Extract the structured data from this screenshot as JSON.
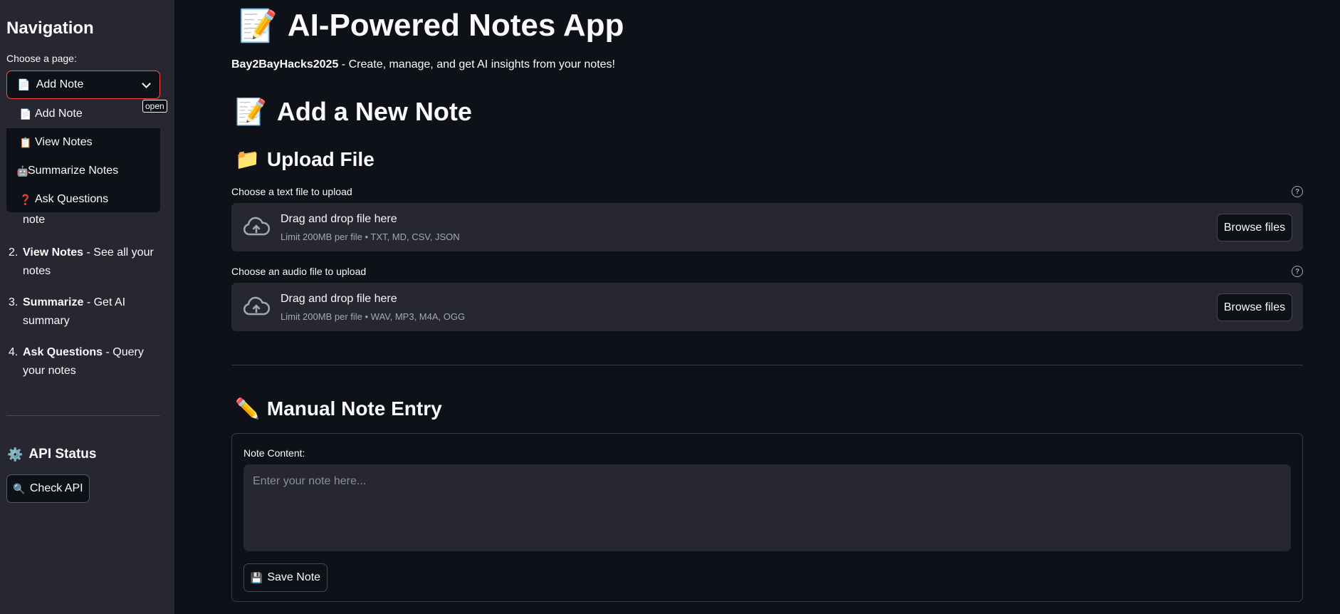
{
  "sidebar": {
    "title": "Navigation",
    "select_label": "Choose a page:",
    "selected_icon": "📄",
    "selected_value": "Add Note",
    "tooltip": "open",
    "options": [
      {
        "icon": "📄",
        "label": "Add Note"
      },
      {
        "icon": "📋",
        "label": "View Notes"
      },
      {
        "icon": "🤖",
        "label": "Summarize Notes"
      },
      {
        "icon": "❓",
        "label": "Ask Questions"
      }
    ],
    "instructions_fragment": "note",
    "instructions": [
      {
        "num": "2.",
        "bold": "View Notes",
        "text": " - See all your notes"
      },
      {
        "num": "3.",
        "bold": "Summarize",
        "text": " - Get AI summary"
      },
      {
        "num": "4.",
        "bold": "Ask Questions",
        "text": " - Query your notes"
      }
    ],
    "api_status_title": "API Status",
    "api_status_icon": "⚙️",
    "check_api_icon": "🔍",
    "check_api_label": "Check API"
  },
  "main": {
    "title_icon": "📝",
    "title": "AI-Powered Notes App",
    "subtitle_bold": "Bay2BayHacks2025",
    "subtitle_text": " - Create, manage, and get AI insights from your notes!",
    "add_heading_icon": "📝",
    "add_heading": "Add a New Note",
    "upload_heading_icon": "📁",
    "upload_heading": "Upload File",
    "text_upload": {
      "label": "Choose a text file to upload",
      "drag_text": "Drag and drop file here",
      "limit_text": "Limit 200MB per file • TXT, MD, CSV, JSON",
      "browse_label": "Browse files"
    },
    "audio_upload": {
      "label": "Choose an audio file to upload",
      "drag_text": "Drag and drop file here",
      "limit_text": "Limit 200MB per file • WAV, MP3, M4A, OGG",
      "browse_label": "Browse files"
    },
    "manual_heading_icon": "✏️",
    "manual_heading": "Manual Note Entry",
    "note_label": "Note Content:",
    "note_placeholder": "Enter your note here...",
    "save_icon": "💾",
    "save_label": "Save Note"
  },
  "colors": {
    "background": "#0e1117",
    "sidebar": "#262730",
    "accent": "#ff4b4b",
    "text": "#fafafa",
    "muted": "#a3a8b8"
  }
}
